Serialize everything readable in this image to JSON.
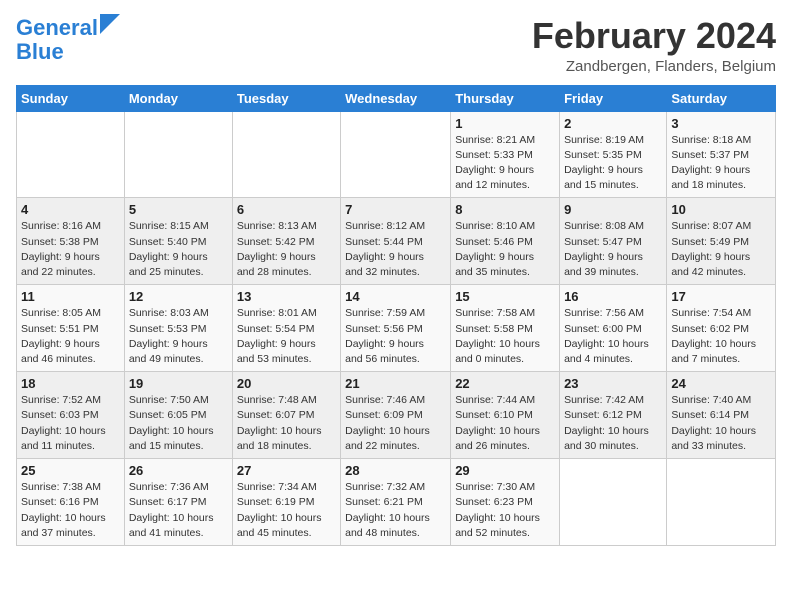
{
  "header": {
    "logo_line1": "General",
    "logo_line2": "Blue",
    "month_title": "February 2024",
    "location": "Zandbergen, Flanders, Belgium"
  },
  "days_of_week": [
    "Sunday",
    "Monday",
    "Tuesday",
    "Wednesday",
    "Thursday",
    "Friday",
    "Saturday"
  ],
  "weeks": [
    [
      {
        "day": "",
        "info": ""
      },
      {
        "day": "",
        "info": ""
      },
      {
        "day": "",
        "info": ""
      },
      {
        "day": "",
        "info": ""
      },
      {
        "day": "1",
        "info": "Sunrise: 8:21 AM\nSunset: 5:33 PM\nDaylight: 9 hours\nand 12 minutes."
      },
      {
        "day": "2",
        "info": "Sunrise: 8:19 AM\nSunset: 5:35 PM\nDaylight: 9 hours\nand 15 minutes."
      },
      {
        "day": "3",
        "info": "Sunrise: 8:18 AM\nSunset: 5:37 PM\nDaylight: 9 hours\nand 18 minutes."
      }
    ],
    [
      {
        "day": "4",
        "info": "Sunrise: 8:16 AM\nSunset: 5:38 PM\nDaylight: 9 hours\nand 22 minutes."
      },
      {
        "day": "5",
        "info": "Sunrise: 8:15 AM\nSunset: 5:40 PM\nDaylight: 9 hours\nand 25 minutes."
      },
      {
        "day": "6",
        "info": "Sunrise: 8:13 AM\nSunset: 5:42 PM\nDaylight: 9 hours\nand 28 minutes."
      },
      {
        "day": "7",
        "info": "Sunrise: 8:12 AM\nSunset: 5:44 PM\nDaylight: 9 hours\nand 32 minutes."
      },
      {
        "day": "8",
        "info": "Sunrise: 8:10 AM\nSunset: 5:46 PM\nDaylight: 9 hours\nand 35 minutes."
      },
      {
        "day": "9",
        "info": "Sunrise: 8:08 AM\nSunset: 5:47 PM\nDaylight: 9 hours\nand 39 minutes."
      },
      {
        "day": "10",
        "info": "Sunrise: 8:07 AM\nSunset: 5:49 PM\nDaylight: 9 hours\nand 42 minutes."
      }
    ],
    [
      {
        "day": "11",
        "info": "Sunrise: 8:05 AM\nSunset: 5:51 PM\nDaylight: 9 hours\nand 46 minutes."
      },
      {
        "day": "12",
        "info": "Sunrise: 8:03 AM\nSunset: 5:53 PM\nDaylight: 9 hours\nand 49 minutes."
      },
      {
        "day": "13",
        "info": "Sunrise: 8:01 AM\nSunset: 5:54 PM\nDaylight: 9 hours\nand 53 minutes."
      },
      {
        "day": "14",
        "info": "Sunrise: 7:59 AM\nSunset: 5:56 PM\nDaylight: 9 hours\nand 56 minutes."
      },
      {
        "day": "15",
        "info": "Sunrise: 7:58 AM\nSunset: 5:58 PM\nDaylight: 10 hours\nand 0 minutes."
      },
      {
        "day": "16",
        "info": "Sunrise: 7:56 AM\nSunset: 6:00 PM\nDaylight: 10 hours\nand 4 minutes."
      },
      {
        "day": "17",
        "info": "Sunrise: 7:54 AM\nSunset: 6:02 PM\nDaylight: 10 hours\nand 7 minutes."
      }
    ],
    [
      {
        "day": "18",
        "info": "Sunrise: 7:52 AM\nSunset: 6:03 PM\nDaylight: 10 hours\nand 11 minutes."
      },
      {
        "day": "19",
        "info": "Sunrise: 7:50 AM\nSunset: 6:05 PM\nDaylight: 10 hours\nand 15 minutes."
      },
      {
        "day": "20",
        "info": "Sunrise: 7:48 AM\nSunset: 6:07 PM\nDaylight: 10 hours\nand 18 minutes."
      },
      {
        "day": "21",
        "info": "Sunrise: 7:46 AM\nSunset: 6:09 PM\nDaylight: 10 hours\nand 22 minutes."
      },
      {
        "day": "22",
        "info": "Sunrise: 7:44 AM\nSunset: 6:10 PM\nDaylight: 10 hours\nand 26 minutes."
      },
      {
        "day": "23",
        "info": "Sunrise: 7:42 AM\nSunset: 6:12 PM\nDaylight: 10 hours\nand 30 minutes."
      },
      {
        "day": "24",
        "info": "Sunrise: 7:40 AM\nSunset: 6:14 PM\nDaylight: 10 hours\nand 33 minutes."
      }
    ],
    [
      {
        "day": "25",
        "info": "Sunrise: 7:38 AM\nSunset: 6:16 PM\nDaylight: 10 hours\nand 37 minutes."
      },
      {
        "day": "26",
        "info": "Sunrise: 7:36 AM\nSunset: 6:17 PM\nDaylight: 10 hours\nand 41 minutes."
      },
      {
        "day": "27",
        "info": "Sunrise: 7:34 AM\nSunset: 6:19 PM\nDaylight: 10 hours\nand 45 minutes."
      },
      {
        "day": "28",
        "info": "Sunrise: 7:32 AM\nSunset: 6:21 PM\nDaylight: 10 hours\nand 48 minutes."
      },
      {
        "day": "29",
        "info": "Sunrise: 7:30 AM\nSunset: 6:23 PM\nDaylight: 10 hours\nand 52 minutes."
      },
      {
        "day": "",
        "info": ""
      },
      {
        "day": "",
        "info": ""
      }
    ]
  ]
}
